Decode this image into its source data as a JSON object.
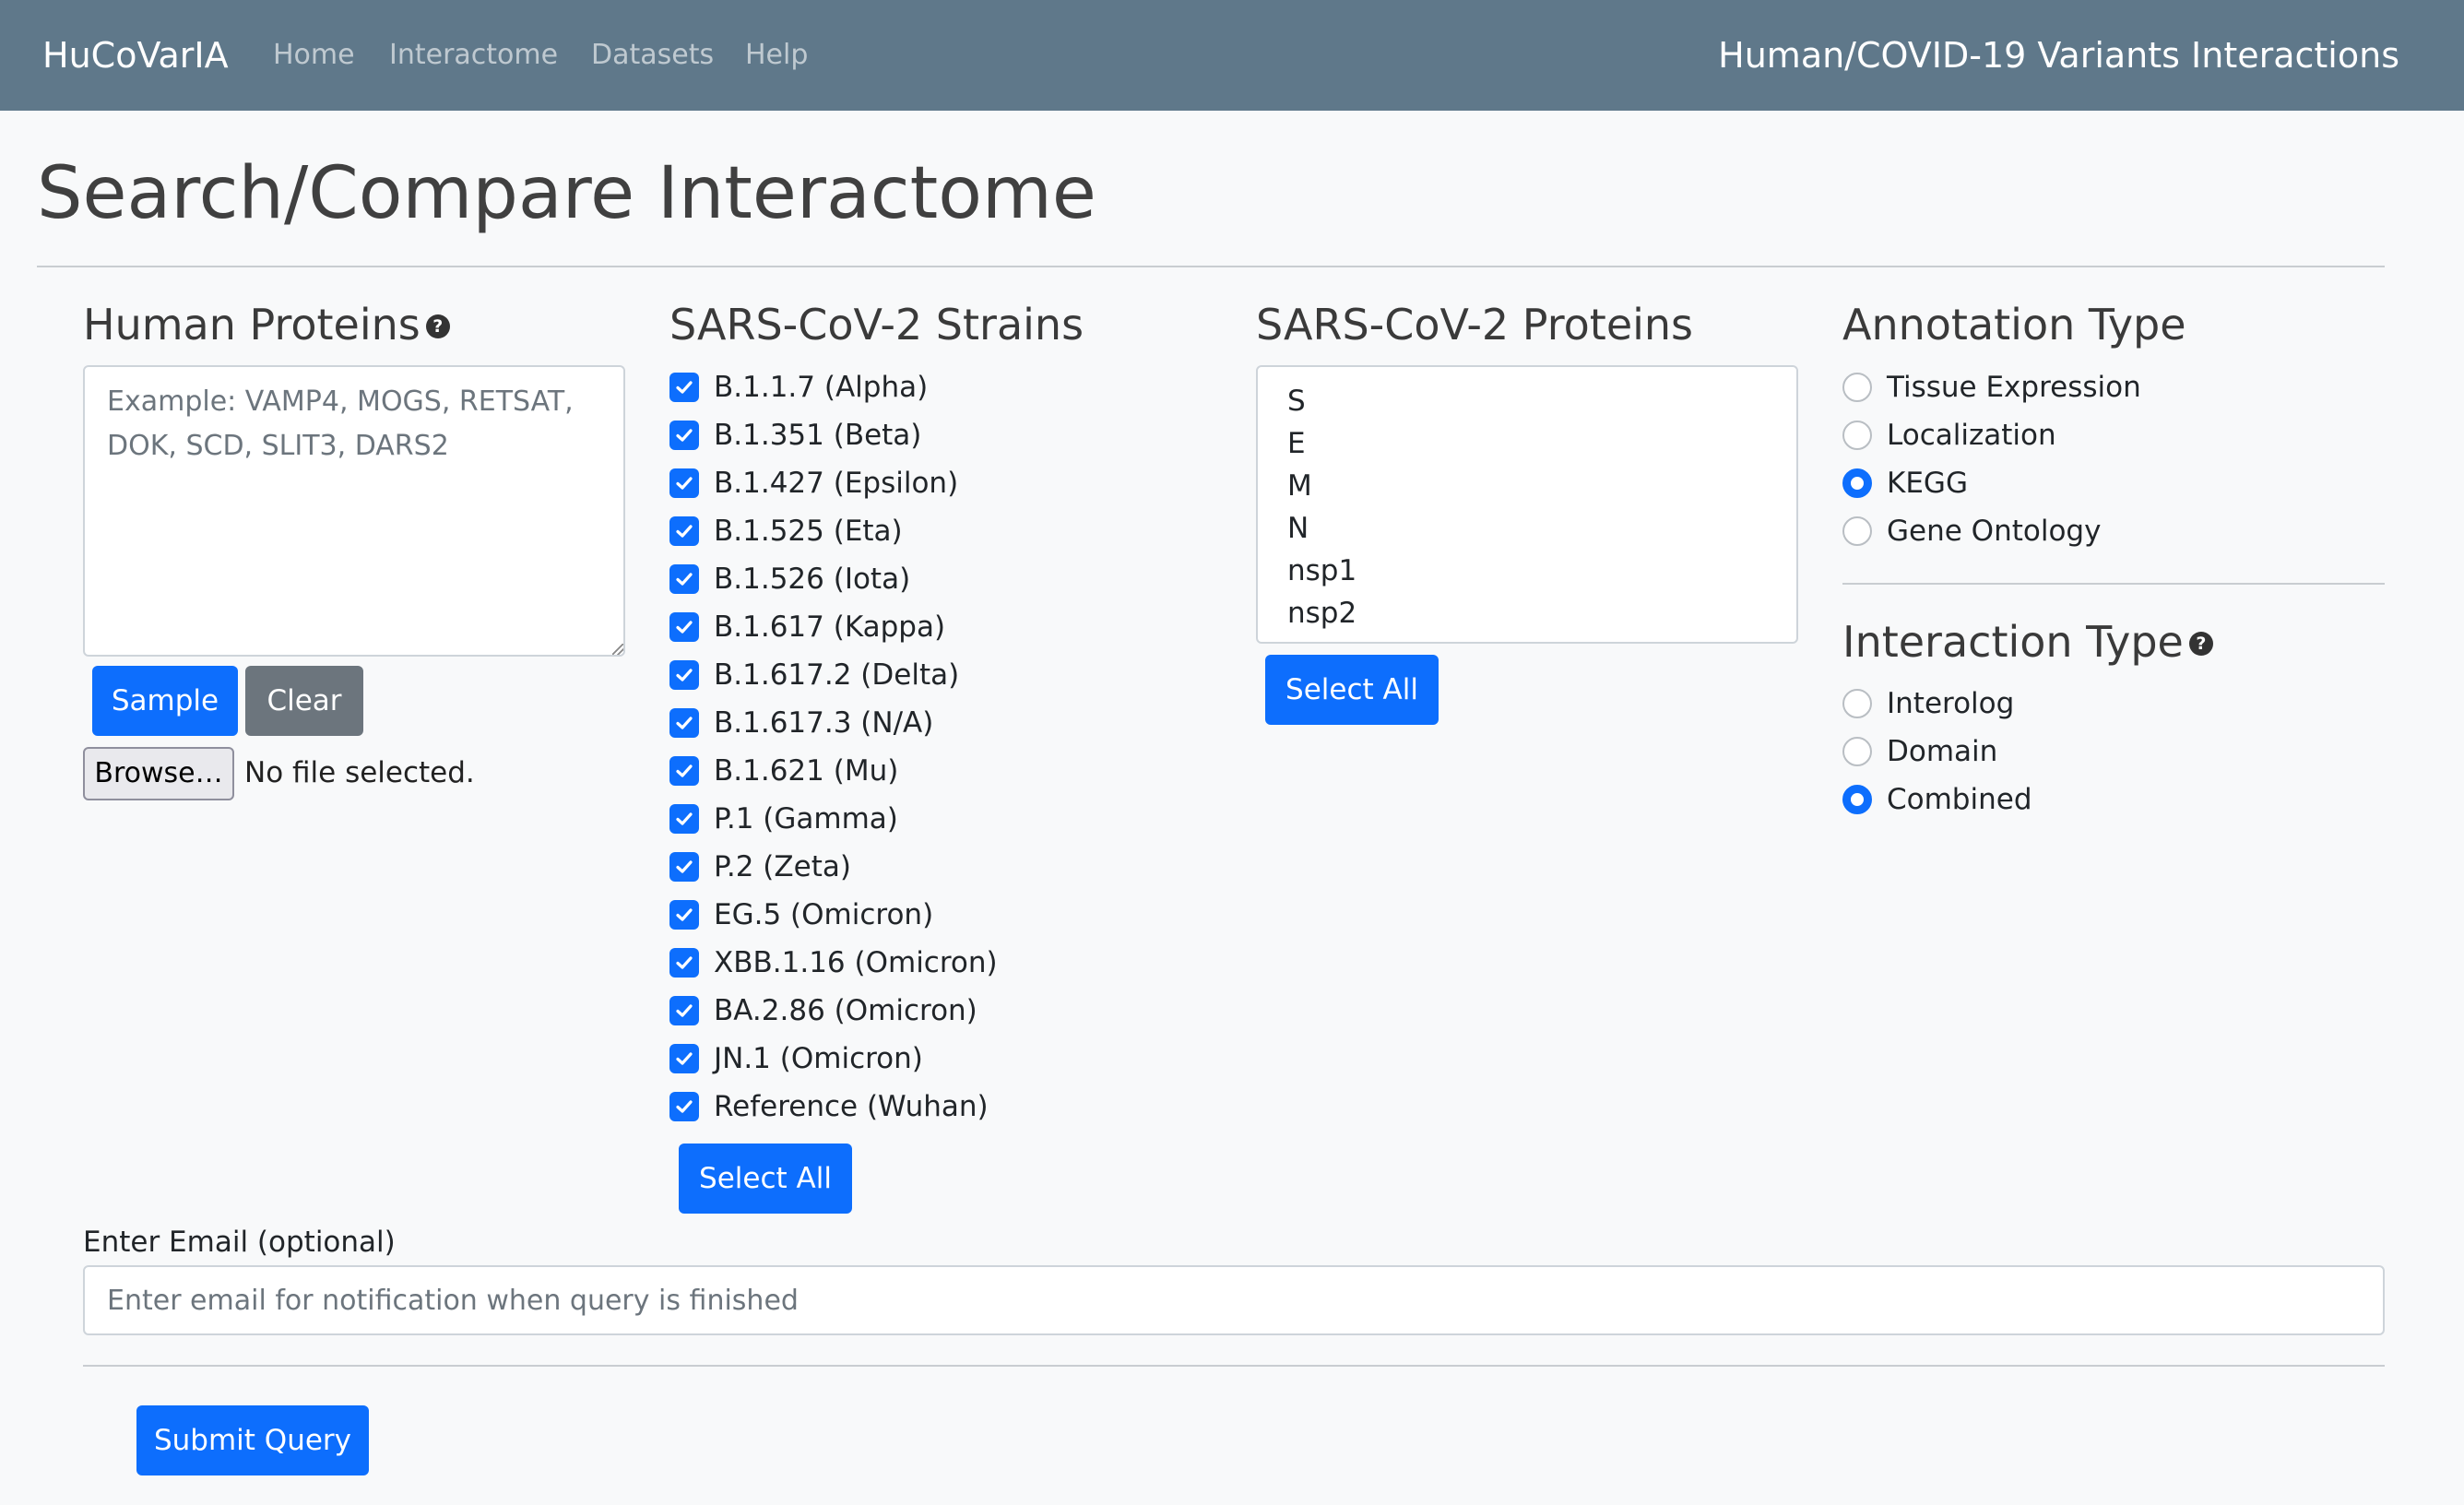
{
  "navbar": {
    "brand": "HuCoVarIA",
    "links": [
      "Home",
      "Interactome",
      "Datasets",
      "Help"
    ],
    "right_title": "Human/COVID-19 Variants Interactions"
  },
  "page": {
    "title": "Search/Compare Interactome"
  },
  "human_proteins": {
    "title": "Human Proteins",
    "help_icon": "question-circle-icon",
    "placeholder": "Example: VAMP4, MOGS, RETSAT, DOK, SCD, SLIT3, DARS2",
    "sample_label": "Sample",
    "clear_label": "Clear",
    "browse_label": "Browse…",
    "file_status": "No file selected."
  },
  "strains": {
    "title": "SARS-CoV-2 Strains",
    "items": [
      {
        "label": "B.1.1.7 (Alpha)",
        "checked": true
      },
      {
        "label": "B.1.351 (Beta)",
        "checked": true
      },
      {
        "label": "B.1.427 (Epsilon)",
        "checked": true
      },
      {
        "label": "B.1.525 (Eta)",
        "checked": true
      },
      {
        "label": "B.1.526 (Iota)",
        "checked": true
      },
      {
        "label": "B.1.617 (Kappa)",
        "checked": true
      },
      {
        "label": "B.1.617.2 (Delta)",
        "checked": true
      },
      {
        "label": "B.1.617.3 (N/A)",
        "checked": true
      },
      {
        "label": "B.1.621 (Mu)",
        "checked": true
      },
      {
        "label": "P.1 (Gamma)",
        "checked": true
      },
      {
        "label": "P.2 (Zeta)",
        "checked": true
      },
      {
        "label": "EG.5 (Omicron)",
        "checked": true
      },
      {
        "label": "XBB.1.16 (Omicron)",
        "checked": true
      },
      {
        "label": "BA.2.86 (Omicron)",
        "checked": true
      },
      {
        "label": "JN.1 (Omicron)",
        "checked": true
      },
      {
        "label": "Reference (Wuhan)",
        "checked": true
      }
    ],
    "select_all_label": "Select All"
  },
  "proteins": {
    "title": "SARS-CoV-2 Proteins",
    "options": [
      "S",
      "E",
      "M",
      "N",
      "nsp1",
      "nsp2"
    ],
    "select_all_label": "Select All"
  },
  "annotation": {
    "title": "Annotation Type",
    "options": [
      {
        "label": "Tissue Expression",
        "checked": false
      },
      {
        "label": "Localization",
        "checked": false
      },
      {
        "label": "KEGG",
        "checked": true
      },
      {
        "label": "Gene Ontology",
        "checked": false
      }
    ]
  },
  "interaction": {
    "title": "Interaction Type",
    "help_icon": "question-circle-icon",
    "options": [
      {
        "label": "Interolog",
        "checked": false
      },
      {
        "label": "Domain",
        "checked": false
      },
      {
        "label": "Combined",
        "checked": true
      }
    ]
  },
  "email": {
    "label": "Enter Email (optional)",
    "placeholder": "Enter email for notification when query is finished",
    "value": ""
  },
  "submit": {
    "label": "Submit Query"
  },
  "colors": {
    "navbar": "#5f788a",
    "primary": "#0d6efd",
    "secondary": "#6c757d",
    "background": "#f8f9fa"
  }
}
